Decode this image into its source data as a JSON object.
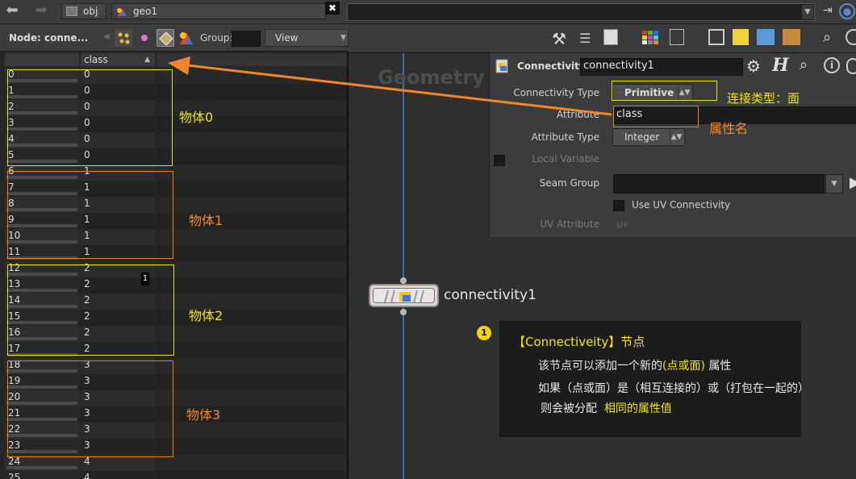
{
  "path_bar": {
    "crumb_obj": "obj",
    "crumb_geo": "geo1"
  },
  "spreadsheet": {
    "node_label": "Node: conne...",
    "group_label": "Group:",
    "view_label": "View",
    "column_header": "class",
    "sort_indicator": "▲",
    "rows": [
      [
        "0",
        "0"
      ],
      [
        "1",
        "0"
      ],
      [
        "2",
        "0"
      ],
      [
        "3",
        "0"
      ],
      [
        "4",
        "0"
      ],
      [
        "5",
        "0"
      ],
      [
        "6",
        "1"
      ],
      [
        "7",
        "1"
      ],
      [
        "8",
        "1"
      ],
      [
        "9",
        "1"
      ],
      [
        "10",
        "1"
      ],
      [
        "11",
        "1"
      ],
      [
        "12",
        "2"
      ],
      [
        "13",
        "2"
      ],
      [
        "14",
        "2"
      ],
      [
        "15",
        "2"
      ],
      [
        "16",
        "2"
      ],
      [
        "17",
        "2"
      ],
      [
        "18",
        "3"
      ],
      [
        "19",
        "3"
      ],
      [
        "20",
        "3"
      ],
      [
        "21",
        "3"
      ],
      [
        "22",
        "3"
      ],
      [
        "23",
        "3"
      ],
      [
        "24",
        "4"
      ],
      [
        "25",
        "4"
      ]
    ],
    "cursor_badge": "1",
    "group_labels": [
      "物体0",
      "物体1",
      "物体2",
      "物体3"
    ]
  },
  "network": {
    "context_label": "Geometry",
    "node_name": "connectivity1"
  },
  "params": {
    "node_type": "Connectivity",
    "node_name": "connectivity1",
    "connectivity_type_label": "Connectivity Type",
    "connectivity_type_value": "Primitive",
    "attribute_label": "Attribute",
    "attribute_value": "class",
    "attribute_type_label": "Attribute Type",
    "attribute_type_value": "Integer",
    "local_variable_label": "Local Variable",
    "seam_group_label": "Seam Group",
    "use_uv_label": "Use UV Connectivity",
    "uv_attribute_label": "UV Attribute",
    "uv_attribute_value": "uv"
  },
  "annotations": {
    "type_note": "连接类型：面",
    "attr_note": "属性名",
    "badge": "1",
    "title": "【Connectiveity】节点",
    "line1_prefix": "该节点可以添加一个新的",
    "line1_highlight": "(点或面)",
    "line1_suffix": "属性",
    "line2": "如果（点或面）是（相互连接的）或（打包在一起的）",
    "line3_prefix": "则会被分配",
    "line3_highlight": "相同的属性值"
  },
  "colors": {
    "yellow": "#f2e600",
    "orange": "#f0882a",
    "wire": "#3b6fa8"
  }
}
